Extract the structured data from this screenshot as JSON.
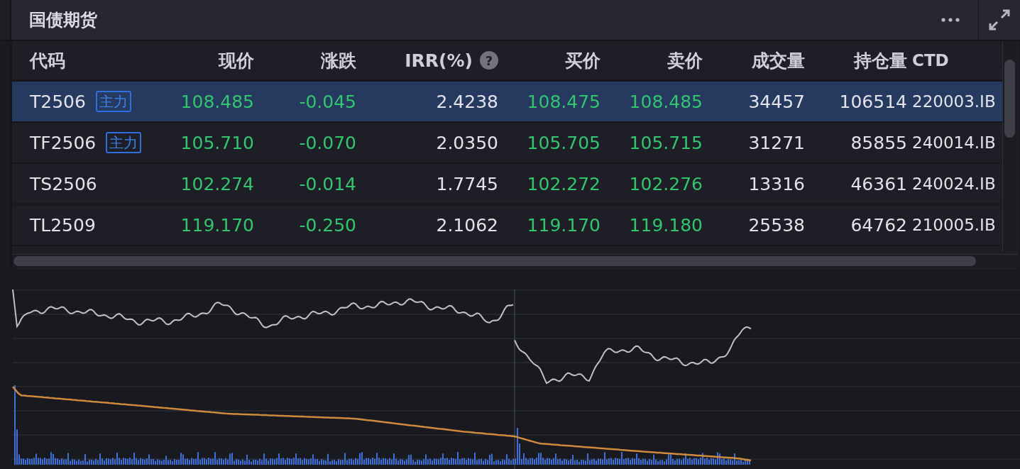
{
  "panel": {
    "title": "国债期货"
  },
  "table": {
    "columns": [
      "代码",
      "现价",
      "涨跌",
      "IRR(%)",
      "买价",
      "卖价",
      "成交量",
      "持仓量",
      "CTD"
    ],
    "help_mark": "?",
    "rows": [
      {
        "code": "T2506",
        "tag": "主力",
        "price": "108.485",
        "change": "-0.045",
        "irr": "2.4238",
        "bid": "108.475",
        "ask": "108.485",
        "volume": "34457",
        "open_interest": "106514",
        "ctd": "220003.IB",
        "selected": true
      },
      {
        "code": "TF2506",
        "tag": "主力",
        "price": "105.710",
        "change": "-0.070",
        "irr": "2.0350",
        "bid": "105.705",
        "ask": "105.715",
        "volume": "31271",
        "open_interest": "85855",
        "ctd": "240014.IB",
        "selected": false
      },
      {
        "code": "TS2506",
        "price": "102.274",
        "change": "-0.014",
        "irr": "1.7745",
        "bid": "102.272",
        "ask": "102.276",
        "volume": "13316",
        "open_interest": "46361",
        "ctd": "240024.IB",
        "selected": false
      },
      {
        "code": "TL2509",
        "price": "119.170",
        "change": "-0.250",
        "irr": "2.1062",
        "bid": "119.170",
        "ask": "119.180",
        "volume": "25538",
        "open_interest": "64762",
        "ctd": "210005.IB",
        "selected": false
      }
    ]
  }
}
